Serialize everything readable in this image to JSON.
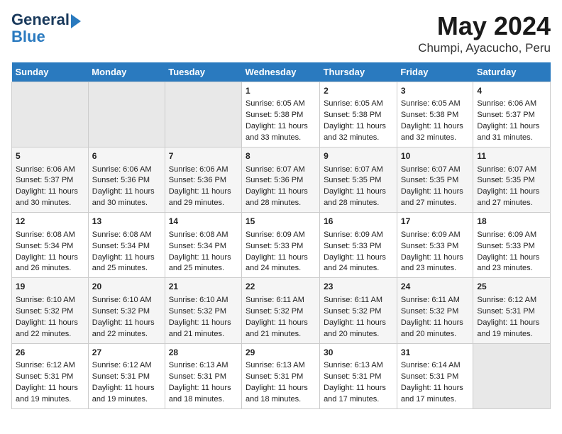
{
  "logo": {
    "line1": "General",
    "line2": "Blue"
  },
  "title": "May 2024",
  "subtitle": "Chumpi, Ayacucho, Peru",
  "days_of_week": [
    "Sunday",
    "Monday",
    "Tuesday",
    "Wednesday",
    "Thursday",
    "Friday",
    "Saturday"
  ],
  "weeks": [
    [
      {
        "day": "",
        "data": ""
      },
      {
        "day": "",
        "data": ""
      },
      {
        "day": "",
        "data": ""
      },
      {
        "day": "1",
        "data": "Sunrise: 6:05 AM\nSunset: 5:38 PM\nDaylight: 11 hours and 33 minutes."
      },
      {
        "day": "2",
        "data": "Sunrise: 6:05 AM\nSunset: 5:38 PM\nDaylight: 11 hours and 32 minutes."
      },
      {
        "day": "3",
        "data": "Sunrise: 6:05 AM\nSunset: 5:38 PM\nDaylight: 11 hours and 32 minutes."
      },
      {
        "day": "4",
        "data": "Sunrise: 6:06 AM\nSunset: 5:37 PM\nDaylight: 11 hours and 31 minutes."
      }
    ],
    [
      {
        "day": "5",
        "data": "Sunrise: 6:06 AM\nSunset: 5:37 PM\nDaylight: 11 hours and 30 minutes."
      },
      {
        "day": "6",
        "data": "Sunrise: 6:06 AM\nSunset: 5:36 PM\nDaylight: 11 hours and 30 minutes."
      },
      {
        "day": "7",
        "data": "Sunrise: 6:06 AM\nSunset: 5:36 PM\nDaylight: 11 hours and 29 minutes."
      },
      {
        "day": "8",
        "data": "Sunrise: 6:07 AM\nSunset: 5:36 PM\nDaylight: 11 hours and 28 minutes."
      },
      {
        "day": "9",
        "data": "Sunrise: 6:07 AM\nSunset: 5:35 PM\nDaylight: 11 hours and 28 minutes."
      },
      {
        "day": "10",
        "data": "Sunrise: 6:07 AM\nSunset: 5:35 PM\nDaylight: 11 hours and 27 minutes."
      },
      {
        "day": "11",
        "data": "Sunrise: 6:07 AM\nSunset: 5:35 PM\nDaylight: 11 hours and 27 minutes."
      }
    ],
    [
      {
        "day": "12",
        "data": "Sunrise: 6:08 AM\nSunset: 5:34 PM\nDaylight: 11 hours and 26 minutes."
      },
      {
        "day": "13",
        "data": "Sunrise: 6:08 AM\nSunset: 5:34 PM\nDaylight: 11 hours and 25 minutes."
      },
      {
        "day": "14",
        "data": "Sunrise: 6:08 AM\nSunset: 5:34 PM\nDaylight: 11 hours and 25 minutes."
      },
      {
        "day": "15",
        "data": "Sunrise: 6:09 AM\nSunset: 5:33 PM\nDaylight: 11 hours and 24 minutes."
      },
      {
        "day": "16",
        "data": "Sunrise: 6:09 AM\nSunset: 5:33 PM\nDaylight: 11 hours and 24 minutes."
      },
      {
        "day": "17",
        "data": "Sunrise: 6:09 AM\nSunset: 5:33 PM\nDaylight: 11 hours and 23 minutes."
      },
      {
        "day": "18",
        "data": "Sunrise: 6:09 AM\nSunset: 5:33 PM\nDaylight: 11 hours and 23 minutes."
      }
    ],
    [
      {
        "day": "19",
        "data": "Sunrise: 6:10 AM\nSunset: 5:32 PM\nDaylight: 11 hours and 22 minutes."
      },
      {
        "day": "20",
        "data": "Sunrise: 6:10 AM\nSunset: 5:32 PM\nDaylight: 11 hours and 22 minutes."
      },
      {
        "day": "21",
        "data": "Sunrise: 6:10 AM\nSunset: 5:32 PM\nDaylight: 11 hours and 21 minutes."
      },
      {
        "day": "22",
        "data": "Sunrise: 6:11 AM\nSunset: 5:32 PM\nDaylight: 11 hours and 21 minutes."
      },
      {
        "day": "23",
        "data": "Sunrise: 6:11 AM\nSunset: 5:32 PM\nDaylight: 11 hours and 20 minutes."
      },
      {
        "day": "24",
        "data": "Sunrise: 6:11 AM\nSunset: 5:32 PM\nDaylight: 11 hours and 20 minutes."
      },
      {
        "day": "25",
        "data": "Sunrise: 6:12 AM\nSunset: 5:31 PM\nDaylight: 11 hours and 19 minutes."
      }
    ],
    [
      {
        "day": "26",
        "data": "Sunrise: 6:12 AM\nSunset: 5:31 PM\nDaylight: 11 hours and 19 minutes."
      },
      {
        "day": "27",
        "data": "Sunrise: 6:12 AM\nSunset: 5:31 PM\nDaylight: 11 hours and 19 minutes."
      },
      {
        "day": "28",
        "data": "Sunrise: 6:13 AM\nSunset: 5:31 PM\nDaylight: 11 hours and 18 minutes."
      },
      {
        "day": "29",
        "data": "Sunrise: 6:13 AM\nSunset: 5:31 PM\nDaylight: 11 hours and 18 minutes."
      },
      {
        "day": "30",
        "data": "Sunrise: 6:13 AM\nSunset: 5:31 PM\nDaylight: 11 hours and 17 minutes."
      },
      {
        "day": "31",
        "data": "Sunrise: 6:14 AM\nSunset: 5:31 PM\nDaylight: 11 hours and 17 minutes."
      },
      {
        "day": "",
        "data": ""
      }
    ]
  ]
}
